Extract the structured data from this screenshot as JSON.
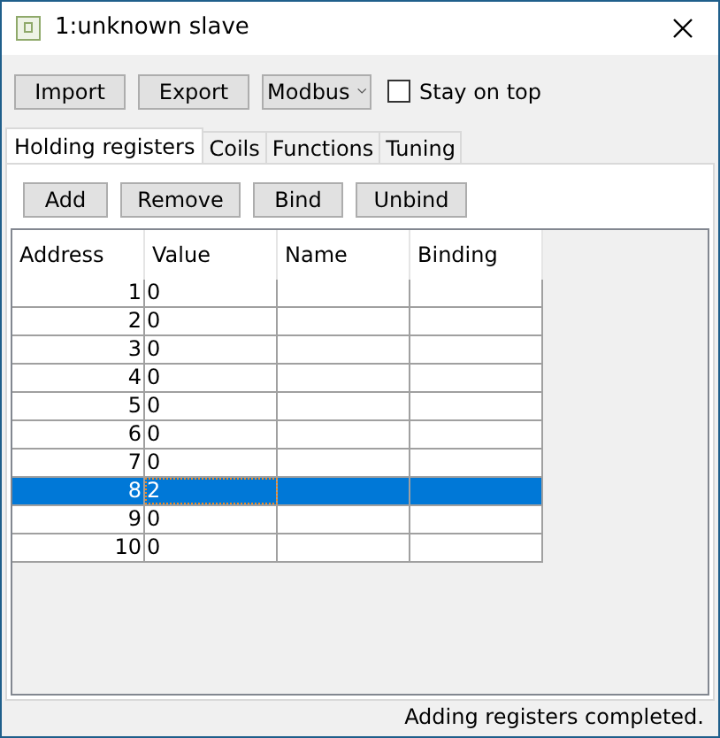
{
  "window": {
    "title": "1:unknown slave"
  },
  "toolbar": {
    "buttons": [
      "Import",
      "Export"
    ],
    "protocol": "Modbus",
    "stay_on_top": {
      "label": "Stay on top",
      "checked": false
    }
  },
  "tabs": [
    {
      "label": "Holding registers",
      "selected": true
    },
    {
      "label": "Coils",
      "selected": false
    },
    {
      "label": "Functions",
      "selected": false
    },
    {
      "label": "Tuning",
      "selected": false
    }
  ],
  "actions": [
    "Add",
    "Remove",
    "Bind",
    "Unbind"
  ],
  "table": {
    "columns": [
      "Address",
      "Value",
      "Name",
      "Binding"
    ],
    "rows": [
      {
        "address": "1",
        "value": "0",
        "selected": false
      },
      {
        "address": "2",
        "value": "0",
        "selected": false
      },
      {
        "address": "3",
        "value": "0",
        "selected": false
      },
      {
        "address": "4",
        "value": "0",
        "selected": false
      },
      {
        "address": "5",
        "value": "0",
        "selected": false
      },
      {
        "address": "6",
        "value": "0",
        "selected": false
      },
      {
        "address": "7",
        "value": "0",
        "selected": false
      },
      {
        "address": "8",
        "value": "2",
        "selected": true
      },
      {
        "address": "9",
        "value": "0",
        "selected": false
      },
      {
        "address": "10",
        "value": "0",
        "selected": false
      }
    ]
  },
  "status_bar": "Adding registers completed."
}
